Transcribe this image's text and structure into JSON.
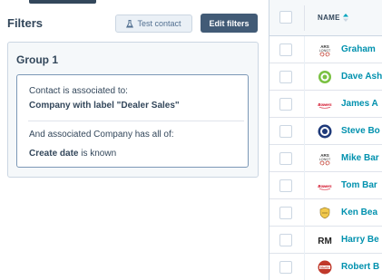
{
  "filters_panel": {
    "title": "Filters",
    "test_contact_label": "Test contact",
    "edit_filters_label": "Edit filters",
    "group": {
      "title": "Group 1",
      "filter": {
        "line1": "Contact is associated to:",
        "line2": "Company with label \"Dealer Sales\"",
        "line3": "And associated Company has all of:",
        "line4_bold": "Create date",
        "line4_rest": " is known"
      }
    }
  },
  "table": {
    "header_name": "NAME",
    "rows": [
      {
        "name": "Graham",
        "logo": "text-logo-icon"
      },
      {
        "name": "Dave Ash",
        "logo": "green-circle-logo-icon"
      },
      {
        "name": "James A",
        "logo": "red-wordmark-logo-icon"
      },
      {
        "name": "Steve Bo",
        "logo": "blue-seal-logo-icon"
      },
      {
        "name": "Mike Bar",
        "logo": "text-logo-icon"
      },
      {
        "name": "Tom Bar",
        "logo": "red-wordmark-logo-icon"
      },
      {
        "name": "Ken Bea",
        "logo": "crest-logo-icon"
      },
      {
        "name": "Harry Be",
        "logo": "rm-logo-icon"
      },
      {
        "name": "Robert B",
        "logo": "red-badge-logo-icon"
      }
    ]
  },
  "colors": {
    "primary_button": "#425b76",
    "link": "#0091ae",
    "text": "#33475b",
    "border": "#cbd6e2"
  }
}
